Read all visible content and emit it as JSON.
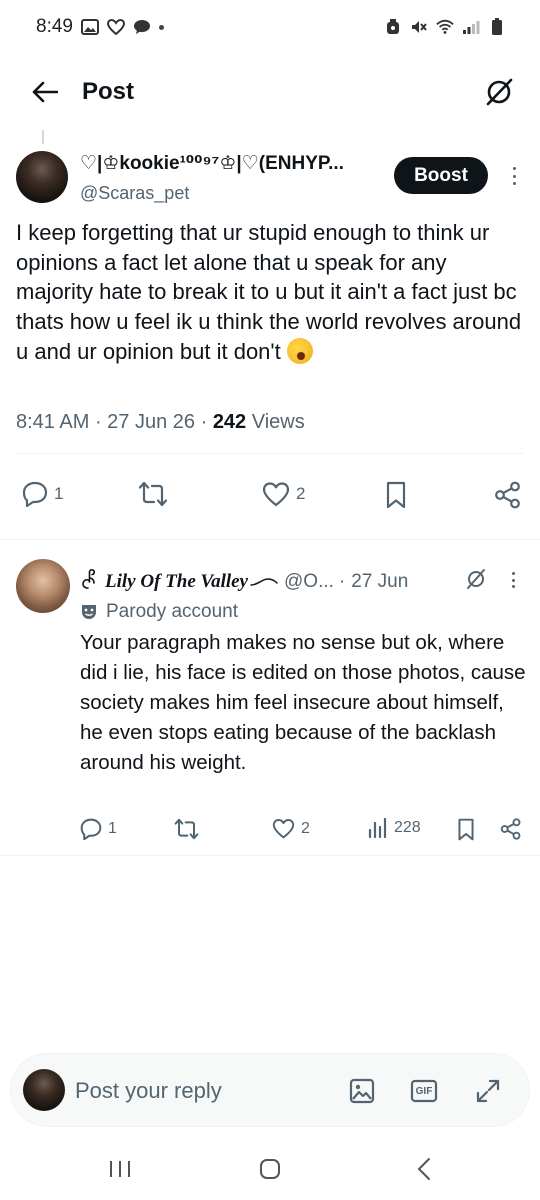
{
  "status_bar": {
    "time": "8:49"
  },
  "header": {
    "title": "Post"
  },
  "post": {
    "display_name": "♡|♔kookie¹⁰⁰⁹⁷♔|♡(ENHYP...",
    "handle": "@Scaras_pet",
    "boost_label": "Boost",
    "text": "I keep forgetting that ur stupid enough to think ur opinions a fact let alone that u speak for any majority hate to break it to u but it ain't a fact just bc thats how u feel ik u think the world revolves around u and ur opinion but it don't",
    "emoji_icon": "yawning-face-emoji",
    "timestamp": "8:41 AM",
    "date": "27 Jun 26",
    "views_count": "242",
    "views_label": "Views",
    "stats": {
      "replies": "1",
      "likes": "2"
    }
  },
  "reply": {
    "display_name": "Lily Of The Valley",
    "handle": "@O...",
    "date": "27 Jun",
    "parody_label": "Parody account",
    "text": "Your paragraph makes no sense but ok, where did i lie, his face is edited on those photos, cause society makes him feel insecure about himself, he even stops eating because of the backlash around his weight.",
    "stats": {
      "replies": "1",
      "likes": "2",
      "views": "228"
    }
  },
  "reply_bar": {
    "placeholder": "Post your reply",
    "gif_label": "GIF"
  },
  "colors": {
    "text_primary": "#0f1419",
    "text_secondary": "#536471",
    "boost_bg": "#0f1419",
    "divider": "#eff3f4",
    "reply_bar_bg": "#f7f9f9"
  }
}
